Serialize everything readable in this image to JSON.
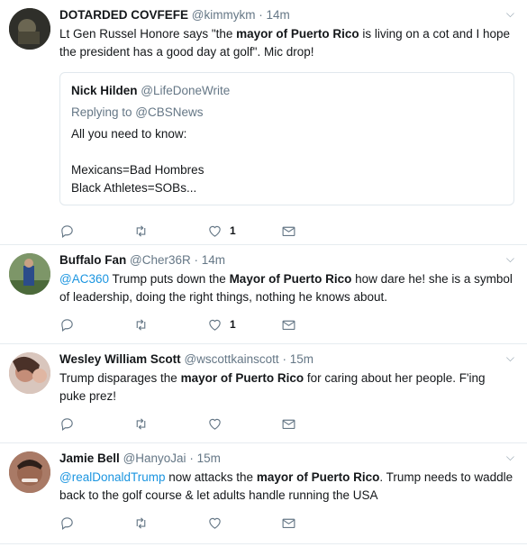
{
  "tweets": [
    {
      "name": "DOTARDED COVFEFE",
      "handle": "@kimmykm",
      "time": "14m",
      "text": [
        {
          "t": "Lt Gen Russel Honore says \"the "
        },
        {
          "t": "mayor of Puerto Rico",
          "b": true
        },
        {
          "t": " is living on a cot and I hope the president has a good day at golf\". Mic drop!"
        }
      ],
      "quote": {
        "name": "Nick Hilden",
        "handle": "@LifeDoneWrite",
        "replying": "Replying to @CBSNews",
        "lines": [
          "All you need to know:",
          "",
          "Mexicans=Bad Hombres",
          "Black Athletes=SOBs..."
        ]
      },
      "likes": "1",
      "avatar_color": "#3a3a33"
    },
    {
      "name": "Buffalo Fan",
      "handle": "@Cher36R",
      "time": "14m",
      "text": [
        {
          "t": "@AC360",
          "link": true
        },
        {
          "t": " Trump puts down the "
        },
        {
          "t": "Mayor of Puerto Rico",
          "b": true
        },
        {
          "t": " how dare he! she is a symbol of leadership, doing the right things, nothing he knows about."
        }
      ],
      "likes": "1",
      "avatar_color": "#6f8a5e"
    },
    {
      "name": "Wesley William Scott",
      "handle": "@wscottkainscott",
      "time": "15m",
      "text": [
        {
          "t": "Trump disparages the "
        },
        {
          "t": "mayor of Puerto Rico",
          "b": true
        },
        {
          "t": " for caring about her people. F'ing puke prez!"
        }
      ],
      "likes": "",
      "avatar_color": "#c79a87"
    },
    {
      "name": "Jamie Bell",
      "handle": "@HanyoJai",
      "time": "15m",
      "text": [
        {
          "t": "@realDonaldTrump",
          "link": true
        },
        {
          "t": " now attacks the "
        },
        {
          "t": "mayor of Puerto Rico",
          "b": true
        },
        {
          "t": ". Trump needs to waddle back to the golf course & let  adults handle running the USA"
        }
      ],
      "likes": "",
      "avatar_color": "#8a5a47"
    }
  ],
  "separator": "·",
  "icons": [
    "reply-icon",
    "retweet-icon",
    "like-icon",
    "message-icon",
    "caret-down-icon"
  ]
}
